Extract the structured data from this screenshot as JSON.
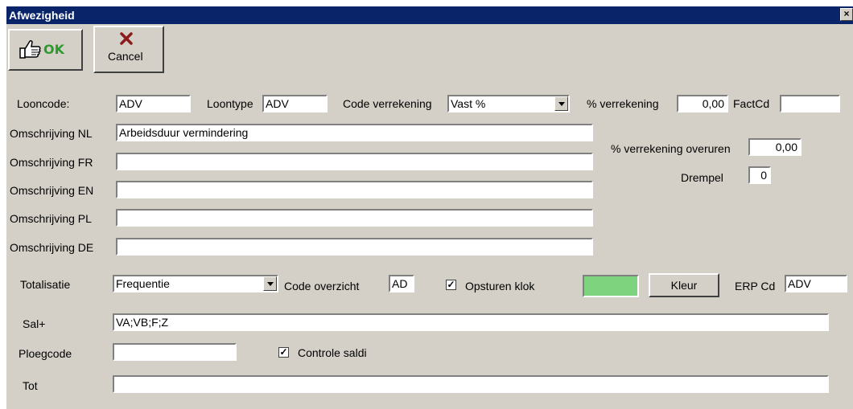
{
  "window": {
    "title": "Afwezigheid",
    "close_symbol": "×"
  },
  "toolbar": {
    "ok_label": "OK",
    "cancel_label": "Cancel"
  },
  "form": {
    "looncode": {
      "label": "Looncode:",
      "value": "ADV"
    },
    "loontype": {
      "label": "Loontype",
      "value": "ADV"
    },
    "code_verrekening": {
      "label": "Code verrekening",
      "value": "Vast %"
    },
    "pct_verrekening": {
      "label": "% verrekening",
      "value": "0,00"
    },
    "factcd": {
      "label": "FactCd",
      "value": ""
    },
    "omschrijving_nl": {
      "label": "Omschrijving NL",
      "value": "Arbeidsduur vermindering"
    },
    "omschrijving_fr": {
      "label": "Omschrijving FR",
      "value": ""
    },
    "omschrijving_en": {
      "label": "Omschrijving EN",
      "value": ""
    },
    "omschrijving_pl": {
      "label": "Omschrijving  PL",
      "value": ""
    },
    "omschrijving_de": {
      "label": "Omschrijving DE",
      "value": ""
    },
    "pct_overuren": {
      "label": "% verrekening overuren",
      "value": "0,00"
    },
    "drempel": {
      "label": "Drempel",
      "value": "0"
    },
    "totalisatie": {
      "label": "Totalisatie",
      "value": "Frequentie"
    },
    "code_overzicht": {
      "label": "Code overzicht",
      "value": "AD"
    },
    "opsturen_klok": {
      "label": "Opsturen klok",
      "checked": true
    },
    "kleur": {
      "label": "Kleur",
      "color": "#7ed37e"
    },
    "erp_cd": {
      "label": "ERP Cd",
      "value": "ADV"
    },
    "sal_plus": {
      "label": "Sal+",
      "value": "VA;VB;F;Z"
    },
    "ploegcode": {
      "label": "Ploegcode",
      "value": ""
    },
    "controle_saldi": {
      "label": "Controle saldi",
      "checked": true
    },
    "tot": {
      "label": "Tot",
      "value": ""
    }
  },
  "colors": {
    "titlebar": "#0a246a",
    "window_bg": "#d4d0c8",
    "ok_green": "#2e9a2e"
  }
}
